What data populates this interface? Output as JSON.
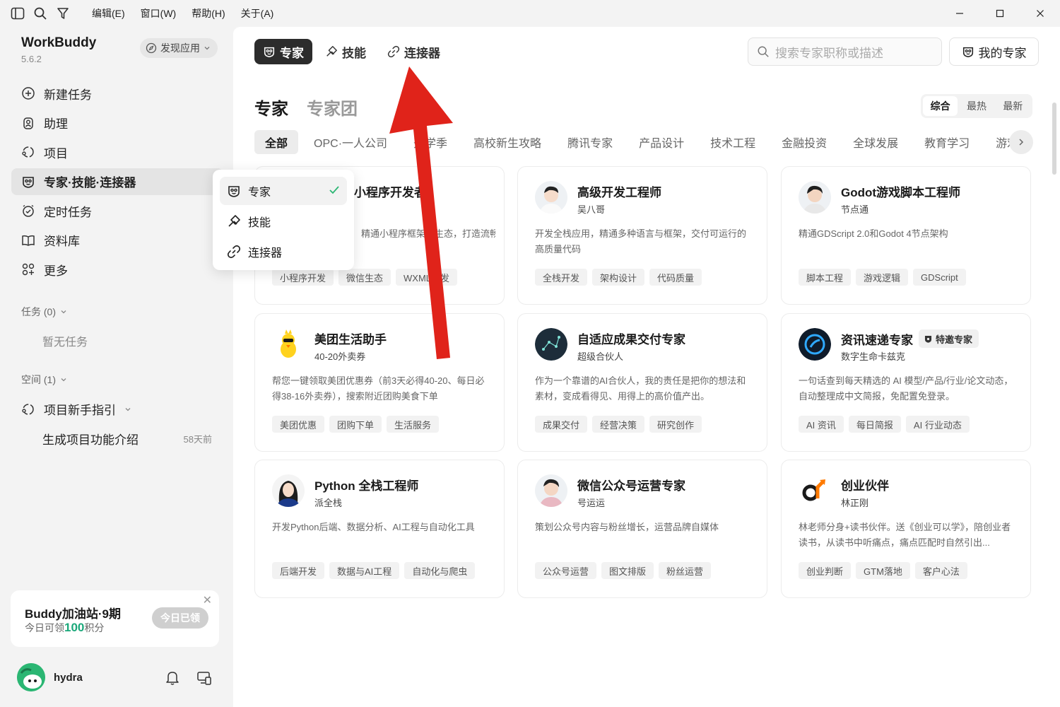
{
  "titlebar": {
    "menus": [
      "编辑(E)",
      "窗口(W)",
      "帮助(H)",
      "关于(A)"
    ]
  },
  "sidebar": {
    "app_name": "WorkBuddy",
    "version": "5.6.2",
    "discover_label": "发现应用",
    "items": [
      {
        "label": "新建任务",
        "icon": "plus-circle-icon"
      },
      {
        "label": "助理",
        "icon": "assistant-icon"
      },
      {
        "label": "项目",
        "icon": "project-icon"
      },
      {
        "label": "专家·技能·连接器",
        "icon": "expert-icon",
        "active": true
      },
      {
        "label": "定时任务",
        "icon": "clock-icon"
      },
      {
        "label": "资料库",
        "icon": "book-icon"
      },
      {
        "label": "更多",
        "icon": "more-icon"
      }
    ],
    "tasks_header": "任务 (0)",
    "tasks_empty": "暂无任务",
    "space_header": "空间 (1)",
    "project_guide": "项目新手指引",
    "project_sub_title": "生成项目功能介绍",
    "project_sub_date": "58天前",
    "promo": {
      "title": "Buddy加油站·9期",
      "sub_prefix": "今日可领",
      "points": "100",
      "sub_suffix": "积分",
      "button": "今日已领"
    },
    "user_name": "hydra"
  },
  "main": {
    "tabs": [
      "专家",
      "技能",
      "连接器"
    ],
    "search_placeholder": "搜索专家职称或描述",
    "my_experts": "我的专家",
    "heading_on": "专家",
    "heading_off": "专家团",
    "sort": [
      "综合",
      "最热",
      "最新"
    ],
    "categories": [
      "全部",
      "OPC·一人公司",
      "开学季",
      "高校新生攻略",
      "腾讯专家",
      "产品设计",
      "技术工程",
      "金融投资",
      "全球发展",
      "教育学习",
      "游戏"
    ],
    "cards": [
      {
        "name": "小程序开发者",
        "author": "",
        "desc": "精通小程序框架和生态，打造流畅微信原",
        "tags": [
          "小程序开发",
          "微信生态",
          "WXML开发"
        ]
      },
      {
        "name": "高级开发工程师",
        "author": "吴八哥",
        "desc": "开发全栈应用，精通多种语言与框架，交付可运行的高质量代码",
        "tags": [
          "全栈开发",
          "架构设计",
          "代码质量"
        ]
      },
      {
        "name": "Godot游戏脚本工程师",
        "author": "节点通",
        "desc": "精通GDScript 2.0和Godot 4节点架构",
        "tags": [
          "脚本工程",
          "游戏逻辑",
          "GDScript"
        ]
      },
      {
        "name": "美团生活助手",
        "author": "40-20外卖券",
        "desc": "帮您一键领取美团优惠券（前3天必得40-20、每日必得38-16外卖券），搜索附近团购美食下单",
        "tags": [
          "美团优惠",
          "团购下单",
          "生活服务"
        ]
      },
      {
        "name": "自适应成果交付专家",
        "author": "超级合伙人",
        "desc": "作为一个靠谱的AI合伙人，我的责任是把你的想法和素材，变成看得见、用得上的高价值产出。",
        "tags": [
          "成果交付",
          "经营决策",
          "研究创作"
        ]
      },
      {
        "name": "资讯速递专家",
        "author": "数字生命卡兹克",
        "desc": "一句话查到每天精选的 AI 模型/产品/行业/论文动态，自动整理成中文简报，免配置免登录。",
        "tags": [
          "AI 资讯",
          "每日简报",
          "AI 行业动态"
        ],
        "badge": "特邀专家"
      },
      {
        "name": "Python 全栈工程师",
        "author": "派全栈",
        "desc": "开发Python后端、数据分析、AI工程与自动化工具",
        "tags": [
          "后端开发",
          "数据与AI工程",
          "自动化与爬虫"
        ]
      },
      {
        "name": "微信公众号运营专家",
        "author": "号运运",
        "desc": "策划公众号内容与粉丝增长，运营品牌自媒体",
        "tags": [
          "公众号运营",
          "图文排版",
          "粉丝运营"
        ]
      },
      {
        "name": "创业伙伴",
        "author": "林正刚",
        "desc": "林老师分身+读书伙伴。送《创业可以学》，陪创业者读书，从读书中听痛点，痛点匹配时自然引出...",
        "tags": [
          "创业判断",
          "GTM落地",
          "客户心法"
        ]
      }
    ]
  },
  "popup": {
    "items": [
      "专家",
      "技能",
      "连接器"
    ]
  },
  "colors": {
    "accent": "#2bb673",
    "arrow": "#e0231a",
    "active_tab": "#2c2c2c"
  }
}
